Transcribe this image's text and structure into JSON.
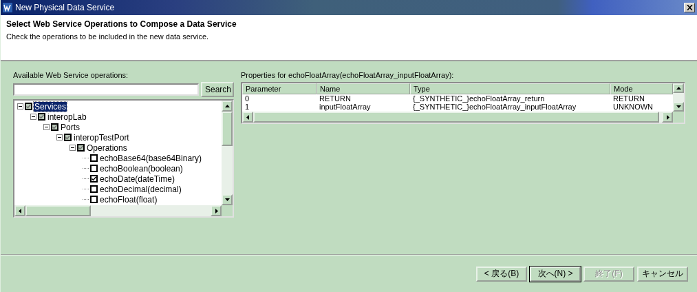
{
  "window": {
    "title": "New Physical Data Service"
  },
  "header": {
    "title": "Select Web Service Operations to Compose a Data Service",
    "description": "Check the operations to be included in the new data service."
  },
  "operations_panel": {
    "label": "Available Web Service operations:",
    "search_button": "Search",
    "tree": [
      {
        "label": "Services",
        "checked": true,
        "disabled": true,
        "expanded": true,
        "selected": true,
        "children": [
          {
            "label": "interopLab",
            "checked": true,
            "disabled": true,
            "expanded": true,
            "selected": false,
            "children": [
              {
                "label": "Ports",
                "checked": true,
                "disabled": true,
                "expanded": true,
                "selected": false,
                "children": [
                  {
                    "label": "interopTestPort",
                    "checked": true,
                    "disabled": true,
                    "expanded": true,
                    "selected": false,
                    "children": [
                      {
                        "label": "Operations",
                        "checked": true,
                        "disabled": true,
                        "expanded": true,
                        "selected": false,
                        "children": [
                          {
                            "label": "echoBase64(base64Binary)",
                            "checked": false,
                            "disabled": false,
                            "selected": false
                          },
                          {
                            "label": "echoBoolean(boolean)",
                            "checked": false,
                            "disabled": false,
                            "selected": false
                          },
                          {
                            "label": "echoDate(dateTime)",
                            "checked": true,
                            "disabled": false,
                            "selected": false
                          },
                          {
                            "label": "echoDecimal(decimal)",
                            "checked": false,
                            "disabled": false,
                            "selected": false
                          },
                          {
                            "label": "echoFloat(float)",
                            "checked": false,
                            "disabled": false,
                            "selected": false
                          }
                        ]
                      }
                    ]
                  }
                ]
              }
            ]
          }
        ]
      }
    ]
  },
  "properties_panel": {
    "label": "Properties for echoFloatArray(echoFloatArray_inputFloatArray):",
    "table": {
      "columns": [
        "Parameter",
        "Name",
        "Type",
        "Mode"
      ],
      "rows": [
        [
          "0",
          "RETURN",
          "{_SYNTHETIC_}echoFloatArray_return",
          "RETURN"
        ],
        [
          "1",
          "inputFloatArray",
          "{_SYNTHETIC_}echoFloatArray_inputFloatArray",
          "UNKNOWN"
        ]
      ]
    }
  },
  "buttons": [
    {
      "label": "< 戻る(B)",
      "disabled": false,
      "default": false
    },
    {
      "label": "次へ(N) >",
      "disabled": false,
      "default": true
    },
    {
      "label": "終了(F)",
      "disabled": true,
      "default": false
    },
    {
      "label": "キャンセル",
      "disabled": false,
      "default": false
    }
  ]
}
